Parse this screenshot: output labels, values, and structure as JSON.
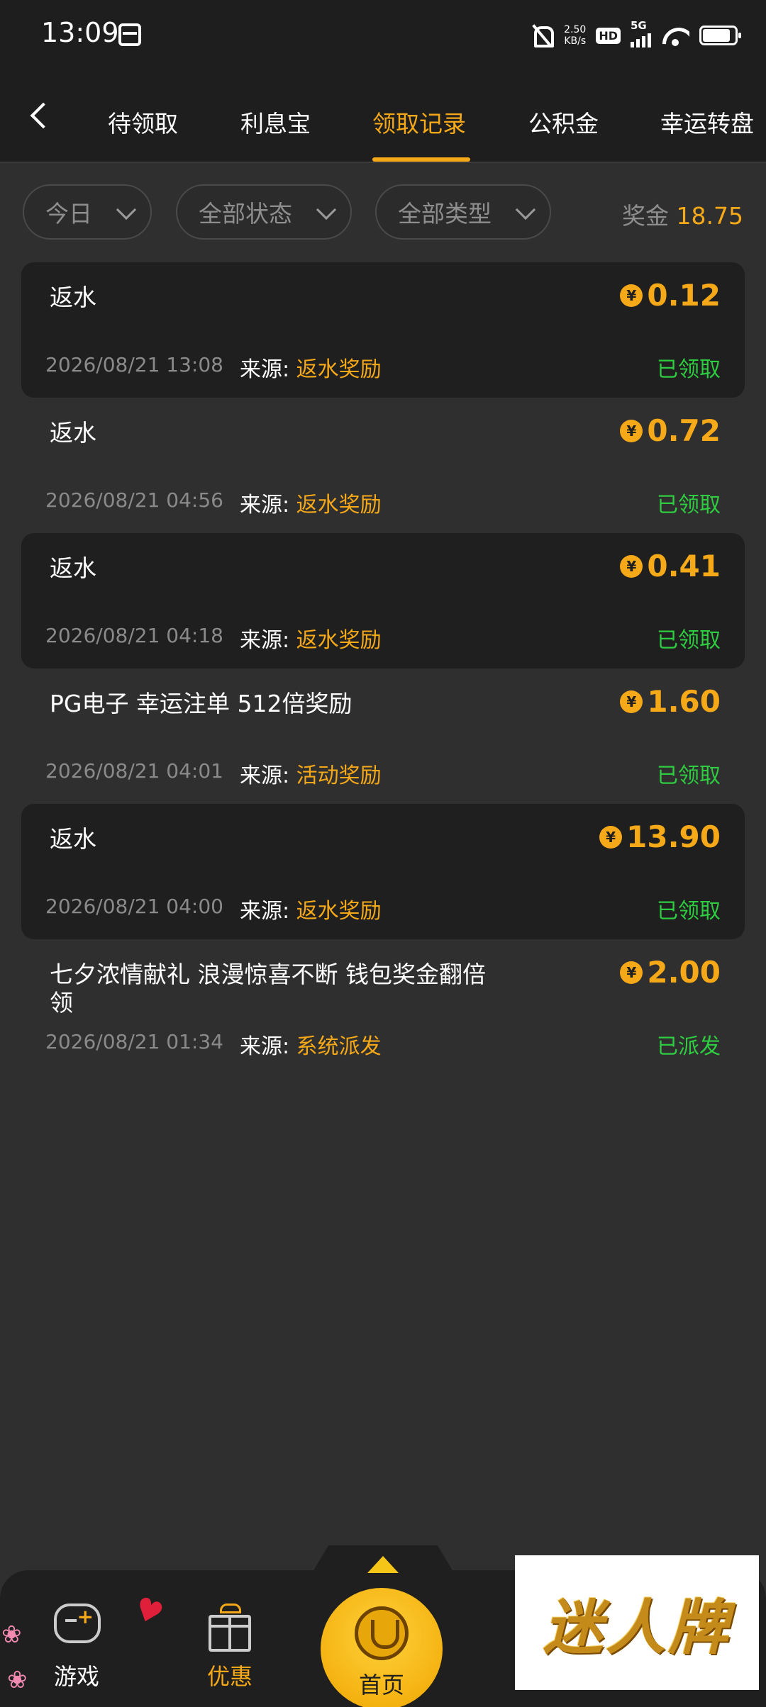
{
  "status_bar": {
    "time": "13:09",
    "speed_value": "2.50",
    "speed_unit": "KB/s",
    "hd": "HD",
    "network": "5G"
  },
  "nav": {
    "tabs": [
      {
        "label": "待领取"
      },
      {
        "label": "利息宝"
      },
      {
        "label": "领取记录",
        "active": true
      },
      {
        "label": "公积金"
      },
      {
        "label": "幸运转盘"
      }
    ]
  },
  "filters": {
    "date": "今日",
    "status": "全部状态",
    "type": "全部类型",
    "bonus_label": "奖金",
    "bonus_value": "18.75"
  },
  "source_label": "来源: ",
  "records": [
    {
      "title": "返水",
      "amount": "0.12",
      "time": "2026/08/21 13:08",
      "source": "返水奖励",
      "status": "已领取"
    },
    {
      "title": "返水",
      "amount": "0.72",
      "time": "2026/08/21 04:56",
      "source": "返水奖励",
      "status": "已领取"
    },
    {
      "title": "返水",
      "amount": "0.41",
      "time": "2026/08/21 04:18",
      "source": "返水奖励",
      "status": "已领取"
    },
    {
      "title": "PG电子 幸运注单 512倍奖励",
      "amount": "1.60",
      "time": "2026/08/21 04:01",
      "source": "活动奖励",
      "status": "已领取"
    },
    {
      "title": "返水",
      "amount": "13.90",
      "time": "2026/08/21 04:00",
      "source": "返水奖励",
      "status": "已领取"
    },
    {
      "title": "七夕浓情献礼 浪漫惊喜不断 钱包奖金翻倍领",
      "amount": "2.00",
      "time": "2026/08/21 01:34",
      "source": "系统派发",
      "status": "已派发"
    }
  ],
  "yen_symbol": "¥",
  "bottom_nav": {
    "games": "游戏",
    "promo": "优惠",
    "home": "首页"
  },
  "brand_logo_text": "迷人牌",
  "colors": {
    "accent": "#f5a818",
    "success": "#2ecc40",
    "background": "#2f2f2f",
    "card_dark": "#1f1f1f"
  }
}
